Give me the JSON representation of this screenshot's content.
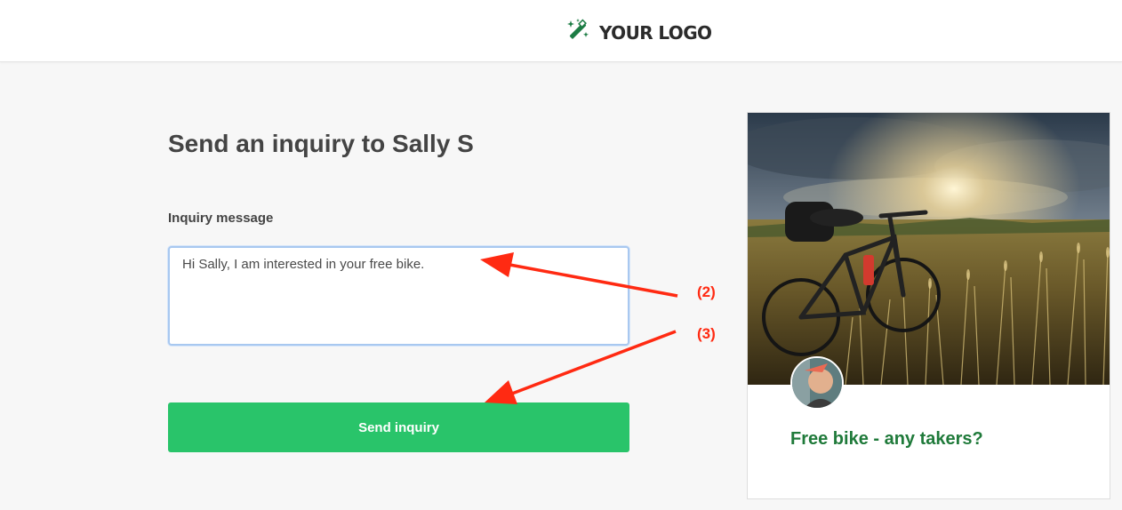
{
  "header": {
    "logo_text": "YOUR LOGO",
    "logo_icon": "magic-wand-icon"
  },
  "form": {
    "title": "Send an inquiry to Sally S",
    "message_label": "Inquiry message",
    "message_value": "Hi Sally, I am interested in your free bike. ",
    "submit_label": "Send inquiry"
  },
  "listing_card": {
    "title": "Free bike - any takers?",
    "image": "mountain-bike-in-wheat-field",
    "avatar": "seller-avatar"
  },
  "annotations": [
    "(2)",
    "(3)"
  ],
  "colors": {
    "primary_button": "#29c46a",
    "card_title": "#1f7a3a",
    "logo_icon": "#1c7c44",
    "annotation": "#ff2a12"
  }
}
